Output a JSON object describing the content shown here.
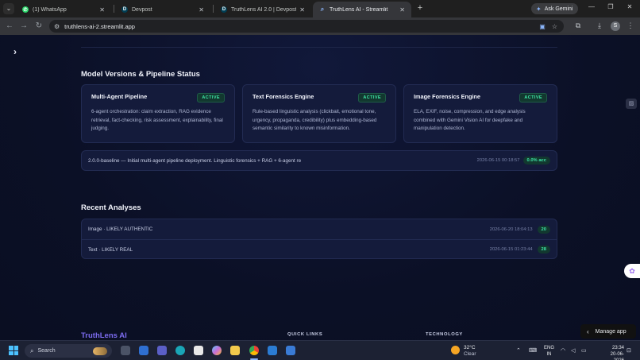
{
  "browser": {
    "tabs": [
      {
        "title": "(1) WhatsApp",
        "favicon": "whatsapp-icon",
        "color": "#25d366"
      },
      {
        "title": "Devpost",
        "favicon": "devpost-icon",
        "color": "#003e54"
      },
      {
        "title": "TruthLens AI 2.0 | Devpost",
        "favicon": "devpost-icon",
        "color": "#003e54"
      },
      {
        "title": "TruthLens AI - Streamlit",
        "favicon": "search-icon",
        "color": "#8ab4f8"
      }
    ],
    "active_tab_index": 3,
    "ask_gemini_label": "Ask Gemini",
    "url": "truthlens-ai-2.streamlit.app",
    "profile_initial": "S"
  },
  "page": {
    "pipeline_section_title": "Model Versions & Pipeline Status",
    "cards": [
      {
        "title": "Multi-Agent Pipeline",
        "status": "ACTIVE",
        "description": "6-agent orchestration: claim extraction, RAG evidence retrieval, fact-checking, risk assessment, explainability, final judging."
      },
      {
        "title": "Text Forensics Engine",
        "status": "ACTIVE",
        "description": "Rule-based linguistic analysis (clickbait, emotional tone, urgency, propaganda, credibility) plus embedding-based semantic similarity to known misinformation."
      },
      {
        "title": "Image Forensics Engine",
        "status": "ACTIVE",
        "description": "ELA, EXIF, noise, compression, and edge analysis combined with Gemini Vision AI for deepfake and manipulation detection."
      }
    ],
    "version": {
      "text": "2.0.0-baseline — Initial multi-agent pipeline deployment. Linguistic forensics + RAG + 6-agent re",
      "date": "2026-06-15 00:18:57",
      "accuracy": "0.0% acc"
    },
    "recent_section_title": "Recent Analyses",
    "recent": [
      {
        "label": "Image · LIKELY AUTHENTIC",
        "date": "2026-06-20 18:04:13",
        "score": "20"
      },
      {
        "label": "Text · LIKELY REAL",
        "date": "2026-06-15 01:23:44",
        "score": "28"
      }
    ],
    "footer": {
      "brand": "TruthLens AI",
      "quick_links_heading": "QUICK LINKS",
      "technology_heading": "TECHNOLOGY"
    },
    "manage_app_label": "Manage app"
  },
  "taskbar": {
    "search_placeholder": "Search",
    "weather_temp": "32°C",
    "weather_condition": "Clear",
    "lang_line1": "ENG",
    "lang_line2": "IN",
    "time": "23:34",
    "date": "20-06-2026"
  },
  "colors": {
    "accent_purple": "#7c6cf0",
    "active_green": "#3ee6a7",
    "page_bg": "#0b1026",
    "card_bg": "#141b3b"
  }
}
